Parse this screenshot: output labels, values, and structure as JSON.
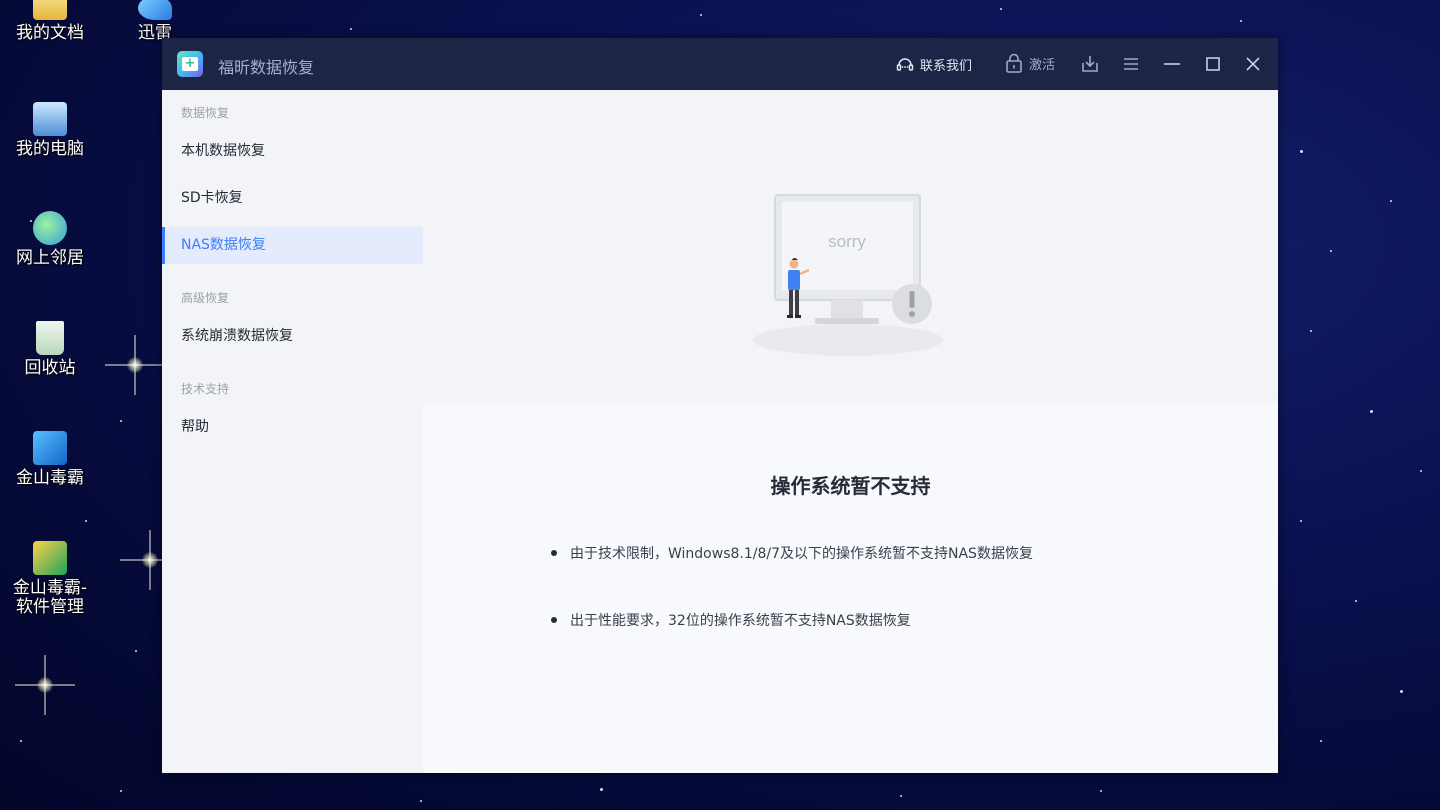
{
  "desktop": {
    "icons": [
      {
        "label": "我的文档"
      },
      {
        "label": "迅雷"
      },
      {
        "label": "我的电脑"
      },
      {
        "label": "网上邻居"
      },
      {
        "label": "回收站"
      },
      {
        "label": "金山毒霸"
      },
      {
        "label_line1": "金山毒霸-",
        "label_line2": "软件管理"
      }
    ]
  },
  "window": {
    "title": "福昕数据恢复",
    "toolbar": {
      "contact_label": "联系我们",
      "activate_label": "激活",
      "icons": [
        "download-icon",
        "menu-icon",
        "minimize-icon",
        "maximize-icon",
        "close-icon"
      ]
    }
  },
  "sidebar": {
    "sections": [
      {
        "title": "数据恢复",
        "items": [
          "本机数据恢复",
          "SD卡恢复",
          "NAS数据恢复"
        ]
      },
      {
        "title": "高级恢复",
        "items": [
          "系统崩溃数据恢复"
        ]
      },
      {
        "title": "技术支持",
        "items": [
          "帮助"
        ]
      }
    ],
    "active_item": "NAS数据恢复"
  },
  "main": {
    "illustration_text": "sorry",
    "notice_title": "操作系统暂不支持",
    "bullets": [
      "由于技术限制，Windows8.1/8/7及以下的操作系统暂不支持NAS数据恢复",
      "出于性能要求，32位的操作系统暂不支持NAS数据恢复"
    ]
  },
  "colors": {
    "titlebar": "#1d2547",
    "accent": "#3d7dff",
    "active_bg": "#e3ebfd"
  }
}
